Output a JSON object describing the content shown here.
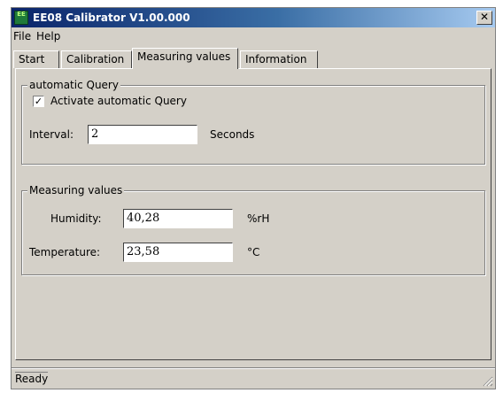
{
  "window": {
    "title": "EE08 Calibrator V1.00.000",
    "app_icon_text": "EE",
    "close_label": "✕"
  },
  "menu": {
    "items": [
      "File",
      "Help"
    ]
  },
  "tabs": [
    {
      "label": "Start",
      "active": false
    },
    {
      "label": "Calibration",
      "active": false
    },
    {
      "label": "Measuring values",
      "active": true
    },
    {
      "label": "Information",
      "active": false
    }
  ],
  "auto_query": {
    "caption": "automatic Query",
    "checkbox_label": "Activate automatic Query",
    "checked": true,
    "checkmark": "✓",
    "interval_label": "Interval:",
    "interval_value": "2",
    "interval_unit": "Seconds"
  },
  "measuring": {
    "caption": "Measuring values",
    "humidity_label": "Humidity:",
    "humidity_value": "40,28",
    "humidity_unit": "%rH",
    "temperature_label": "Temperature:",
    "temperature_value": "23,58",
    "temperature_unit": "°C"
  },
  "status": {
    "text": "Ready"
  }
}
